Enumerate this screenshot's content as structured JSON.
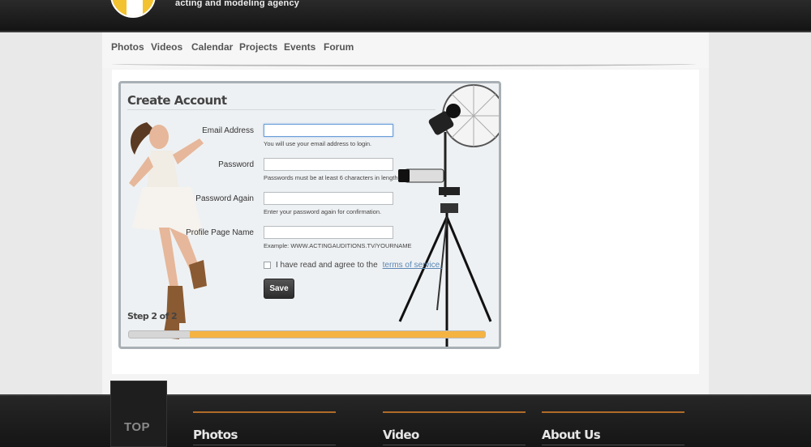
{
  "header": {
    "tagline": "acting and modeling agency"
  },
  "nav": {
    "items": [
      "Photos",
      "Videos",
      "Calendar",
      "Projects",
      "Events",
      "Forum"
    ]
  },
  "form": {
    "title": "Create Account",
    "fields": [
      {
        "label": "Email Address",
        "value": "",
        "help": "You will use your email address to login."
      },
      {
        "label": "Password",
        "value": "",
        "help": "Passwords must be at least 6 characters in length."
      },
      {
        "label": "Password Again",
        "value": "",
        "help": "Enter your password again for confirmation."
      },
      {
        "label": "Profile Page Name",
        "value": "",
        "help": "Example: WWW.ACTINGAUDITIONS.TV/YOURNAME"
      }
    ],
    "agree_text": "I have read and agree to the",
    "tos_link": "terms of service.",
    "agree_checked": false,
    "save_label": "Save",
    "step_label": "Step 2 of 2",
    "progress_fraction": 0.83
  },
  "colors": {
    "accent": "#f5b342",
    "footer_rule": "#b06b28",
    "link": "#5b87b5"
  },
  "footer": {
    "top_label": "TOP",
    "columns": [
      "Photos",
      "Video",
      "About Us"
    ]
  }
}
